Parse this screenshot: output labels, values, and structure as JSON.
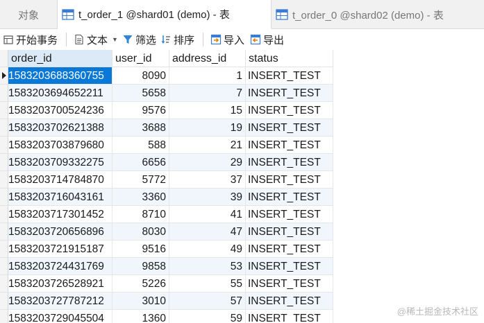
{
  "tabs": {
    "objects_label": "对象",
    "active_label": "t_order_1 @shard01 (demo) - 表",
    "inactive_label": "t_order_0 @shard02 (demo) - 表"
  },
  "toolbar": {
    "begin_transaction": "开始事务",
    "text": "文本",
    "filter": "筛选",
    "sort": "排序",
    "import": "导入",
    "export": "导出"
  },
  "columns": [
    "order_id",
    "user_id",
    "address_id",
    "status"
  ],
  "rows": [
    {
      "order_id": "1583203688360755",
      "user_id": "8090",
      "address_id": "1",
      "status": "INSERT_TEST"
    },
    {
      "order_id": "1583203694652211",
      "user_id": "5658",
      "address_id": "7",
      "status": "INSERT_TEST"
    },
    {
      "order_id": "1583203700524236",
      "user_id": "9576",
      "address_id": "15",
      "status": "INSERT_TEST"
    },
    {
      "order_id": "1583203702621388",
      "user_id": "3688",
      "address_id": "19",
      "status": "INSERT_TEST"
    },
    {
      "order_id": "1583203703879680",
      "user_id": "588",
      "address_id": "21",
      "status": "INSERT_TEST"
    },
    {
      "order_id": "1583203709332275",
      "user_id": "6656",
      "address_id": "29",
      "status": "INSERT_TEST"
    },
    {
      "order_id": "1583203714784870",
      "user_id": "5772",
      "address_id": "37",
      "status": "INSERT_TEST"
    },
    {
      "order_id": "1583203716043161",
      "user_id": "3360",
      "address_id": "39",
      "status": "INSERT_TEST"
    },
    {
      "order_id": "1583203717301452",
      "user_id": "8710",
      "address_id": "41",
      "status": "INSERT_TEST"
    },
    {
      "order_id": "1583203720656896",
      "user_id": "8030",
      "address_id": "47",
      "status": "INSERT_TEST"
    },
    {
      "order_id": "1583203721915187",
      "user_id": "9516",
      "address_id": "49",
      "status": "INSERT_TEST"
    },
    {
      "order_id": "1583203724431769",
      "user_id": "9858",
      "address_id": "53",
      "status": "INSERT_TEST"
    },
    {
      "order_id": "1583203726528921",
      "user_id": "5226",
      "address_id": "55",
      "status": "INSERT_TEST"
    },
    {
      "order_id": "1583203727787212",
      "user_id": "3010",
      "address_id": "57",
      "status": "INSERT_TEST"
    },
    {
      "order_id": "1583203729045504",
      "user_id": "1360",
      "address_id": "59",
      "status": "INSERT_TEST"
    }
  ],
  "watermark": "@稀土掘金技术社区",
  "colors": {
    "selection": "#0a78d7",
    "alt_row": "#f1f6fd",
    "header_active": "#dceaf7"
  },
  "icons": {
    "tab": "table-icon",
    "begin_transaction": "transaction-icon",
    "text": "text-document-icon",
    "filter": "filter-icon",
    "sort": "sort-icon",
    "import": "import-icon",
    "export": "export-icon"
  }
}
